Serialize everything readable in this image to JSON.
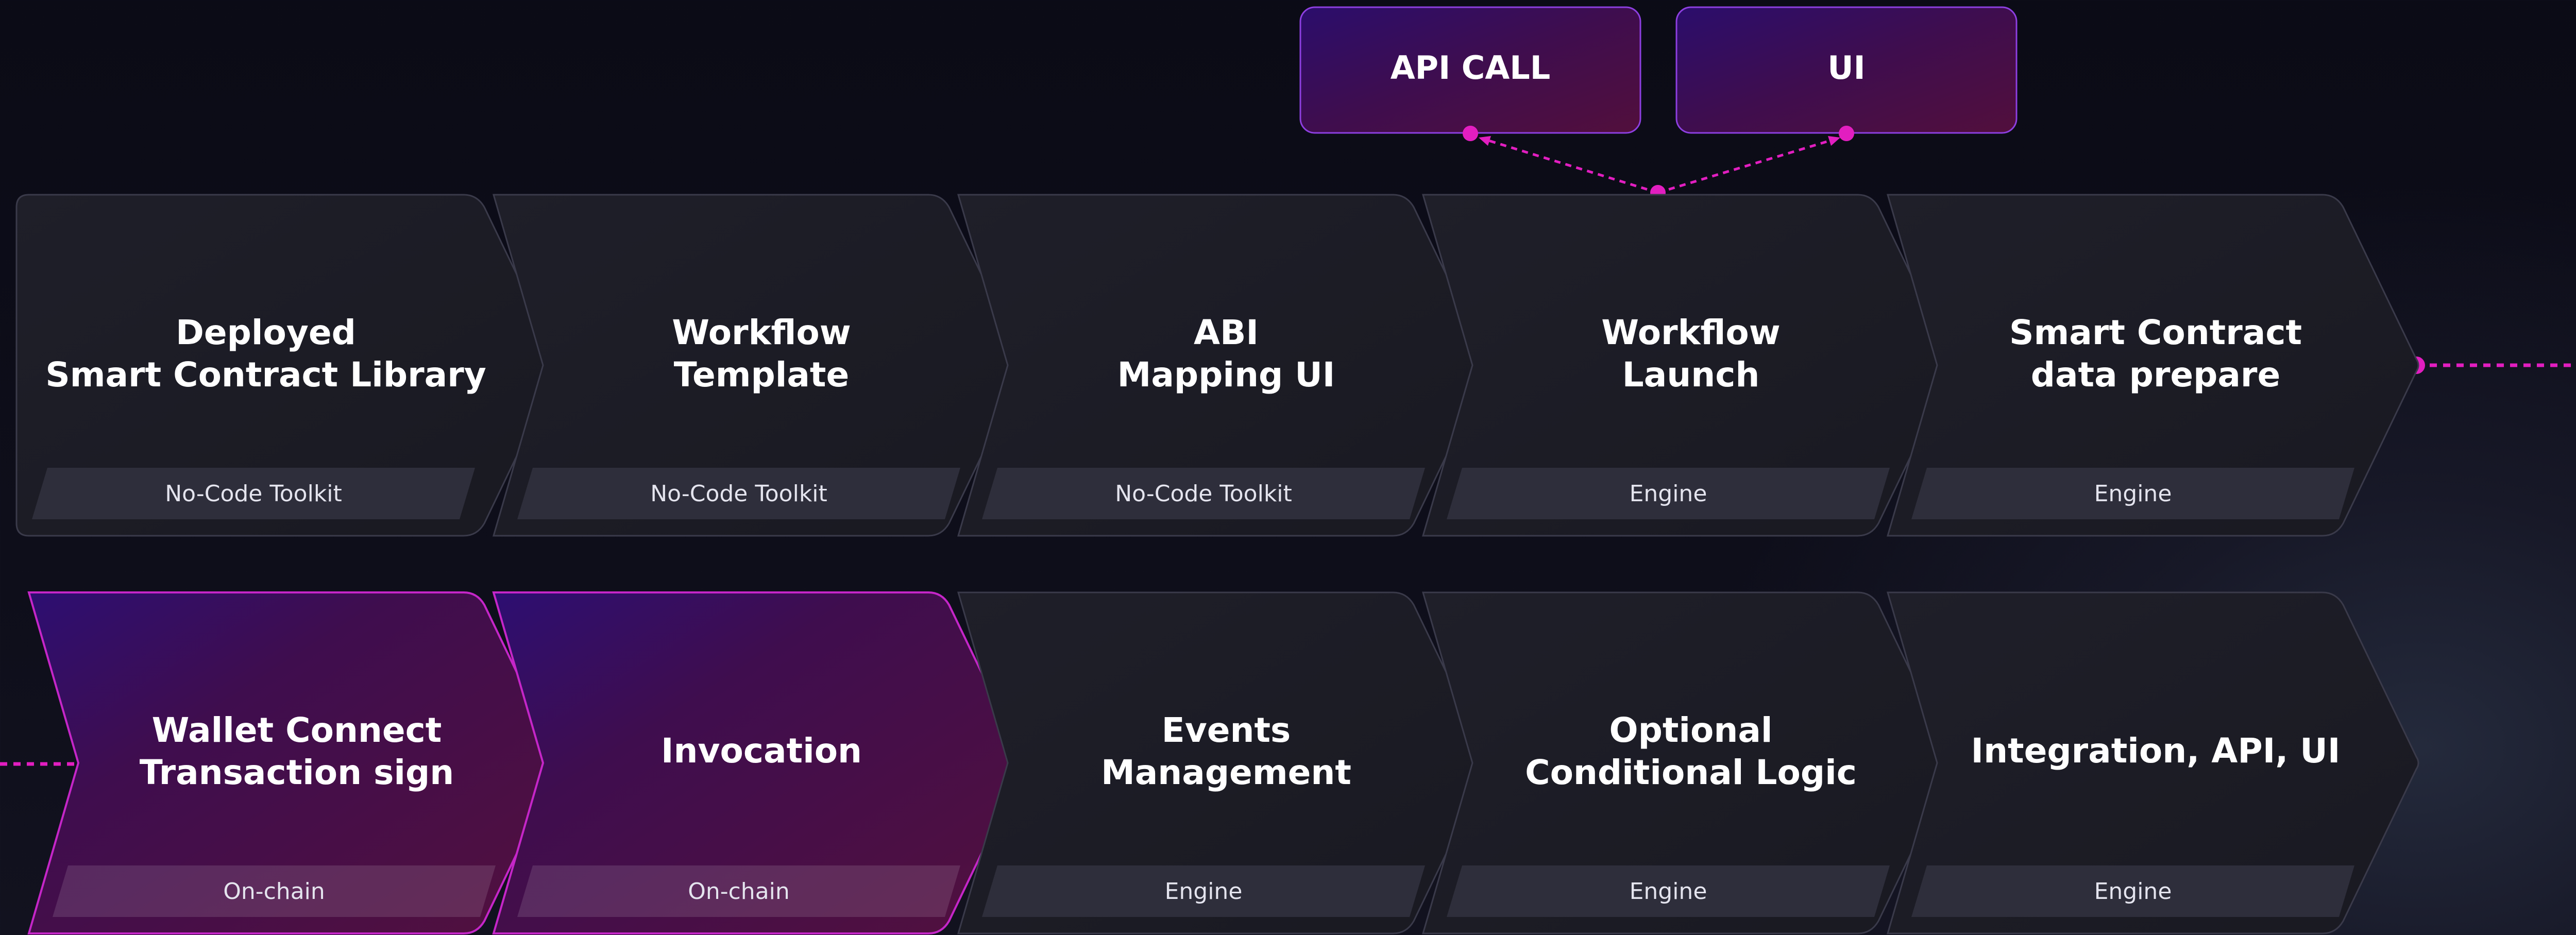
{
  "top_boxes": [
    {
      "label": "API CALL"
    },
    {
      "label": "UI"
    }
  ],
  "steps_row1": [
    {
      "title": [
        "Deployed",
        "Smart Contract Library"
      ],
      "tag": "No-Code Toolkit"
    },
    {
      "title": [
        "Workflow",
        "Template"
      ],
      "tag": "No-Code Toolkit"
    },
    {
      "title": [
        "ABI",
        "Mapping UI"
      ],
      "tag": "No-Code Toolkit"
    },
    {
      "title": [
        "Workflow",
        "Launch"
      ],
      "tag": "Engine"
    },
    {
      "title": [
        "Smart Contract",
        "data prepare"
      ],
      "tag": "Engine"
    }
  ],
  "steps_row2": [
    {
      "title": [
        "Wallet Connect",
        "Transaction sign"
      ],
      "tag": "On-chain",
      "highlight": true
    },
    {
      "title": [
        "Invocation"
      ],
      "tag": "On-chain",
      "highlight": true
    },
    {
      "title": [
        "Events",
        "Management"
      ],
      "tag": "Engine",
      "highlight": false
    },
    {
      "title": [
        "Optional",
        "Conditional Logic"
      ],
      "tag": "Engine",
      "highlight": false
    },
    {
      "title": [
        "Integration, API, UI"
      ],
      "tag": "Engine",
      "highlight": false
    }
  ],
  "colors": {
    "accent": "#e21ec0",
    "box_border": "#3a3a4a",
    "highlight_border": "#c526c8",
    "tag_fill": "#2e2e3b"
  }
}
